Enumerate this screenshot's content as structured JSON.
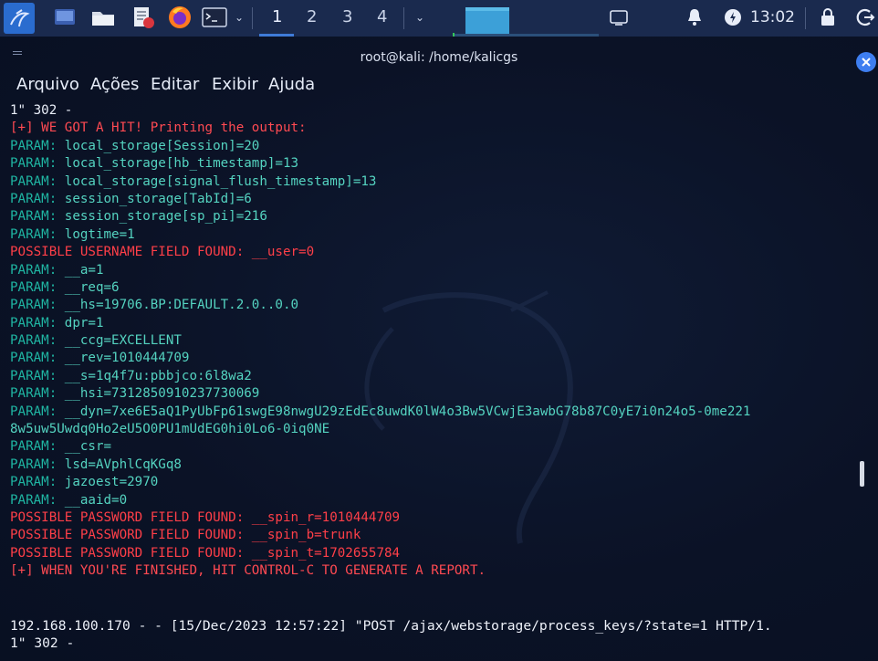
{
  "panel": {
    "workspaces": [
      "1",
      "2",
      "3",
      "4"
    ],
    "active_workspace": "1",
    "clock": "13:02"
  },
  "window": {
    "title": "root@kali: /home/kalicgs"
  },
  "menu": [
    "Arquivo",
    "Ações",
    "Editar",
    "Exibir",
    "Ajuda"
  ],
  "terminal_lines": [
    {
      "kind": "white",
      "text": "1\" 302 -"
    },
    {
      "kind": "hit",
      "prefix": "[+]",
      "text": " WE GOT A HIT! Printing the output:"
    },
    {
      "kind": "param",
      "label": "PARAM:",
      "value": " local_storage[Session]=20"
    },
    {
      "kind": "param",
      "label": "PARAM:",
      "value": " local_storage[hb_timestamp]=13"
    },
    {
      "kind": "param",
      "label": "PARAM:",
      "value": " local_storage[signal_flush_timestamp]=13"
    },
    {
      "kind": "param",
      "label": "PARAM:",
      "value": " session_storage[TabId]=6"
    },
    {
      "kind": "param",
      "label": "PARAM:",
      "value": " session_storage[sp_pi]=216"
    },
    {
      "kind": "param",
      "label": "PARAM:",
      "value": " logtime=1"
    },
    {
      "kind": "red",
      "text": "POSSIBLE USERNAME FIELD FOUND: __user=0"
    },
    {
      "kind": "param",
      "label": "PARAM:",
      "value": " __a=1"
    },
    {
      "kind": "param",
      "label": "PARAM:",
      "value": " __req=6"
    },
    {
      "kind": "param",
      "label": "PARAM:",
      "value": " __hs=19706.BP:DEFAULT.2.0..0.0"
    },
    {
      "kind": "param",
      "label": "PARAM:",
      "value": " dpr=1"
    },
    {
      "kind": "param",
      "label": "PARAM:",
      "value": " __ccg=EXCELLENT"
    },
    {
      "kind": "param",
      "label": "PARAM:",
      "value": " __rev=1010444709"
    },
    {
      "kind": "param",
      "label": "PARAM:",
      "value": " __s=1q4f7u:pbbjco:6l8wa2"
    },
    {
      "kind": "param",
      "label": "PARAM:",
      "value": " __hsi=7312850910237730069"
    },
    {
      "kind": "param",
      "label": "PARAM:",
      "value": " __dyn=7xe6E5aQ1PyUbFp61swgE98nwgU29zEdEc8uwdK0lW4o3Bw5VCwjE3awbG78b87C0yE7i0n24o5-0me221"
    },
    {
      "kind": "cont",
      "value": "8w5uw5Uwdq0Ho2eU5O0PU1mUdEG0hi0Lo6-0iq0NE"
    },
    {
      "kind": "param",
      "label": "PARAM:",
      "value": " __csr="
    },
    {
      "kind": "param",
      "label": "PARAM:",
      "value": " lsd=AVphlCqKGq8"
    },
    {
      "kind": "param",
      "label": "PARAM:",
      "value": " jazoest=2970"
    },
    {
      "kind": "param",
      "label": "PARAM:",
      "value": " __aaid=0"
    },
    {
      "kind": "red",
      "text": "POSSIBLE PASSWORD FIELD FOUND: __spin_r=1010444709"
    },
    {
      "kind": "red",
      "text": "POSSIBLE PASSWORD FIELD FOUND: __spin_b=trunk"
    },
    {
      "kind": "red",
      "text": "POSSIBLE PASSWORD FIELD FOUND: __spin_t=1702655784"
    },
    {
      "kind": "hit",
      "prefix": "[+]",
      "text": " WHEN YOU'RE FINISHED, HIT CONTROL-C TO GENERATE A REPORT."
    }
  ],
  "bottom_lines": [
    "192.168.100.170 - - [15/Dec/2023 12:57:22] \"POST /ajax/webstorage/process_keys/?state=1 HTTP/1.",
    "1\" 302 -"
  ],
  "colors": {
    "param_label": "#1fb5a2",
    "param_value": "#54d3c0",
    "alert": "#ff3f48",
    "panel": "#1a2a4e",
    "background": "#0b1226"
  }
}
